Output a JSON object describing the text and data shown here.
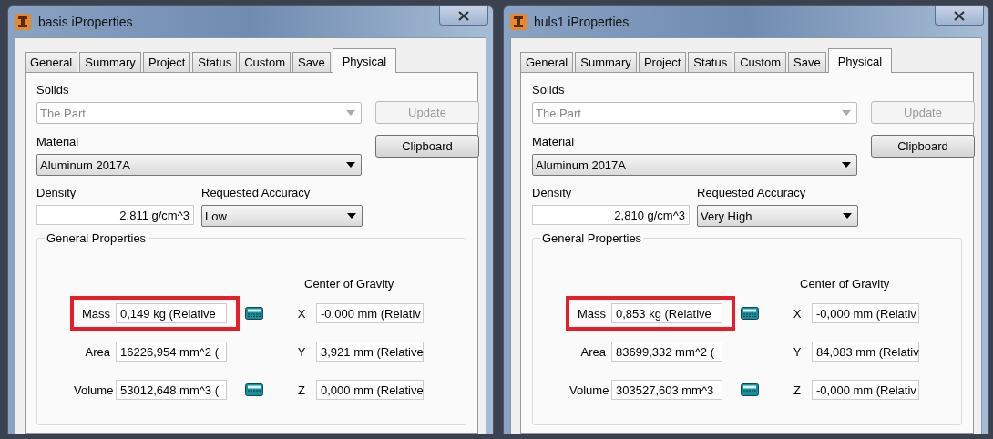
{
  "windows": [
    {
      "title": "basis iProperties",
      "tabs": [
        {
          "label": "General",
          "selected": false
        },
        {
          "label": "Summary",
          "selected": false
        },
        {
          "label": "Project",
          "selected": false
        },
        {
          "label": "Status",
          "selected": false
        },
        {
          "label": "Custom",
          "selected": false
        },
        {
          "label": "Save",
          "selected": false
        },
        {
          "label": "Physical",
          "selected": true
        }
      ],
      "solids": {
        "label": "Solids",
        "value": "The Part",
        "disabled": true
      },
      "update_button": {
        "label": "Update",
        "disabled": true
      },
      "clipboard_button": {
        "label": "Clipboard",
        "disabled": false
      },
      "material": {
        "label": "Material",
        "value": "Aluminum 2017A",
        "disabled": false
      },
      "density": {
        "label": "Density",
        "value": "2,811 g/cm^3"
      },
      "accuracy": {
        "label": "Requested Accuracy",
        "value": "Low",
        "disabled": false
      },
      "general_properties": {
        "title": "General Properties",
        "center_of_gravity_title": "Center of Gravity",
        "rows": [
          {
            "label": "Mass",
            "value": "0,149 kg (Relative",
            "calculator": true,
            "highlighted": true,
            "axis": "X",
            "cog_value": "-0,000 mm (Relativ"
          },
          {
            "label": "Area",
            "value": "16226,954 mm^2 (",
            "calculator": false,
            "highlighted": false,
            "axis": "Y",
            "cog_value": "3,921 mm (Relative"
          },
          {
            "label": "Volume",
            "value": "53012,648 mm^3 (",
            "calculator": true,
            "highlighted": false,
            "axis": "Z",
            "cog_value": "0,000 mm (Relative"
          }
        ]
      }
    },
    {
      "title": "huls1 iProperties",
      "tabs": [
        {
          "label": "General",
          "selected": false
        },
        {
          "label": "Summary",
          "selected": false
        },
        {
          "label": "Project",
          "selected": false
        },
        {
          "label": "Status",
          "selected": false
        },
        {
          "label": "Custom",
          "selected": false
        },
        {
          "label": "Save",
          "selected": false
        },
        {
          "label": "Physical",
          "selected": true
        }
      ],
      "solids": {
        "label": "Solids",
        "value": "The Part",
        "disabled": true
      },
      "update_button": {
        "label": "Update",
        "disabled": true
      },
      "clipboard_button": {
        "label": "Clipboard",
        "disabled": false
      },
      "material": {
        "label": "Material",
        "value": "Aluminum 2017A",
        "disabled": false
      },
      "density": {
        "label": "Density",
        "value": "2,810 g/cm^3"
      },
      "accuracy": {
        "label": "Requested Accuracy",
        "value": "Very High",
        "disabled": false
      },
      "general_properties": {
        "title": "General Properties",
        "center_of_gravity_title": "Center of Gravity",
        "rows": [
          {
            "label": "Mass",
            "value": "0,853 kg (Relative",
            "calculator": true,
            "highlighted": true,
            "axis": "X",
            "cog_value": "-0,000 mm (Relativ"
          },
          {
            "label": "Area",
            "value": "83699,332 mm^2 (",
            "calculator": false,
            "highlighted": false,
            "axis": "Y",
            "cog_value": "84,083 mm (Relativ"
          },
          {
            "label": "Volume",
            "value": "303527,603 mm^3",
            "calculator": true,
            "highlighted": false,
            "axis": "Z",
            "cog_value": "-0,000 mm (Relativ"
          }
        ]
      }
    }
  ]
}
